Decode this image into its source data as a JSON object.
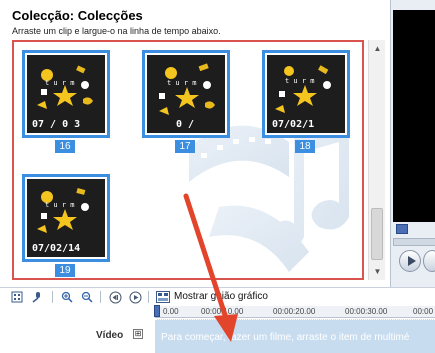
{
  "window": {
    "title": "Colecção: Colecções",
    "subtitle": "Arraste um clip e largue-o na linha de tempo abaixo."
  },
  "clips": [
    {
      "id": "16",
      "caption": "07 / 0 3"
    },
    {
      "id": "17",
      "caption": "0 /"
    },
    {
      "id": "18",
      "caption": "07/02/1"
    },
    {
      "id": "19",
      "caption": "07/02/14"
    }
  ],
  "toolbar": {
    "storyboard_label": "Mostrar guião gráfico",
    "icons": [
      "storyboard-icon",
      "microphone-icon",
      "zoom-in-icon",
      "zoom-out-icon",
      "rewind-icon",
      "play-icon",
      "timeline-toggle-icon"
    ]
  },
  "timeline": {
    "ruler_ticks": [
      "0.00",
      "00:00:10.00",
      "00:00:20.00",
      "00:00:30.00",
      "00:00"
    ],
    "track_label": "Vídeo",
    "expand_symbol": "⊞",
    "track_hint": "Para começar, fazer um filme, arraste o item de multimé"
  },
  "colors": {
    "selection_blue": "#3b8ee0",
    "highlight_red": "#d9534f",
    "arrow_red": "#e2452b",
    "track_blue": "#c8dcef"
  }
}
